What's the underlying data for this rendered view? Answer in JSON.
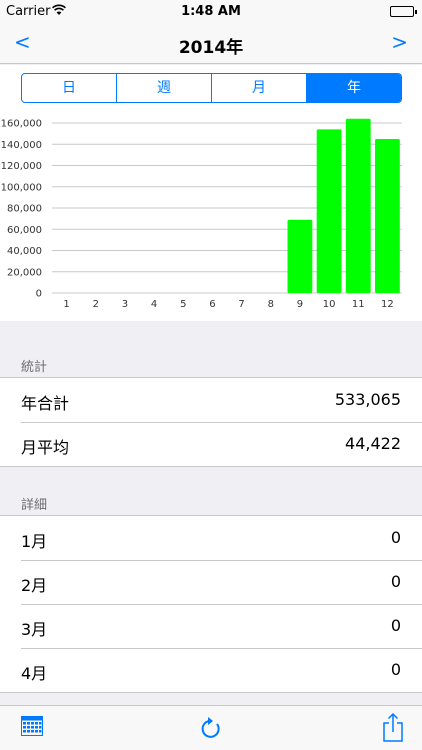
{
  "status_bar": {
    "carrier": "Carrier",
    "time": "1:48 AM"
  },
  "nav": {
    "prev": "<",
    "title": "2014年",
    "next": ">"
  },
  "segments": [
    {
      "label": "日",
      "active": false
    },
    {
      "label": "週",
      "active": false
    },
    {
      "label": "月",
      "active": false
    },
    {
      "label": "年",
      "active": true
    }
  ],
  "chart_data": {
    "type": "bar",
    "categories": [
      "1",
      "2",
      "3",
      "4",
      "5",
      "6",
      "7",
      "8",
      "9",
      "10",
      "11",
      "12"
    ],
    "values": [
      0,
      0,
      0,
      0,
      0,
      0,
      0,
      0,
      69000,
      154000,
      164000,
      145000
    ],
    "yticks": [
      0,
      20000,
      40000,
      60000,
      80000,
      100000,
      120000,
      140000,
      160000
    ],
    "ytick_labels": [
      "0",
      "20,000",
      "40,000",
      "60,000",
      "80,000",
      "100,000",
      "120,000",
      "140,000",
      "160,000"
    ],
    "ylim": [
      0,
      160000
    ],
    "color": "#00ff00",
    "grid": true
  },
  "stats": {
    "header": "統計",
    "rows": [
      {
        "label": "年合計",
        "value": "533,065"
      },
      {
        "label": "月平均",
        "value": "44,422"
      }
    ]
  },
  "details": {
    "header": "詳細",
    "rows": [
      {
        "label": "1月",
        "value": "0"
      },
      {
        "label": "2月",
        "value": "0"
      },
      {
        "label": "3月",
        "value": "0"
      },
      {
        "label": "4月",
        "value": "0"
      }
    ]
  },
  "colors": {
    "accent": "#007aff",
    "bar": "#00ff00"
  },
  "toolbar_icons": [
    "calendar-icon",
    "refresh-icon",
    "share-icon"
  ]
}
